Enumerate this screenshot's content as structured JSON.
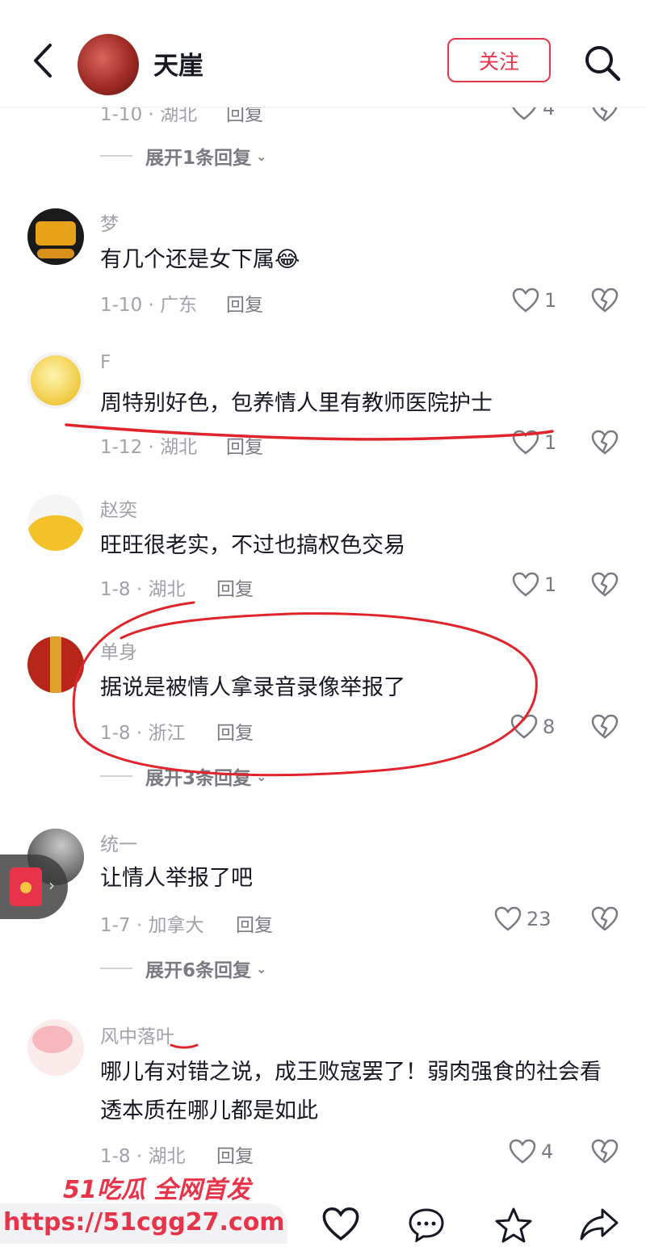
{
  "header": {
    "user_name": "天崖",
    "follow_label": "关注"
  },
  "top_partial": {
    "meta": "1-10 · 湖北",
    "reply": "回复",
    "likes": "4",
    "expand": "展开1条回复"
  },
  "comments": [
    {
      "user": "梦",
      "text": "有几个还是女下属😂",
      "meta": "1-10 · 广东",
      "reply": "回复",
      "likes": "1"
    },
    {
      "user": "F",
      "text": "周特别好色，包养情人里有教师医院护士",
      "meta": "1-12 · 湖北",
      "reply": "回复",
      "likes": "1"
    },
    {
      "user": "赵奕",
      "text": "旺旺很老实，不过也搞权色交易",
      "meta": "1-8 · 湖北",
      "reply": "回复",
      "likes": "1"
    },
    {
      "user": "单身",
      "text": "据说是被情人拿录音录像举报了",
      "meta": "1-8 · 浙江",
      "reply": "回复",
      "likes": "8",
      "expand": "展开3条回复"
    },
    {
      "user": "统一",
      "text": "让情人举报了吧",
      "meta": "1-7 · 加拿大",
      "reply": "回复",
      "likes": "23",
      "expand": "展开6条回复"
    },
    {
      "user": "风中落叶",
      "text": "哪儿有对错之说，成王败寇罢了！弱肉强食的社会看透本质在哪儿都是如此",
      "meta": "1-8 · 湖北",
      "reply": "回复",
      "likes": "4"
    }
  ],
  "watermark": {
    "line1": "51吃瓜 全网首发",
    "line2": "https://51cgg27.com"
  },
  "icons": [
    "back-arrow-icon",
    "search-icon",
    "heart-icon",
    "broken-heart-icon",
    "chevron-down-icon",
    "red-packet-icon",
    "comment-icon",
    "star-icon",
    "share-icon"
  ],
  "colors": {
    "accent": "#e8344a",
    "annotation": "#e0242c",
    "meta": "#a1a1a8"
  }
}
